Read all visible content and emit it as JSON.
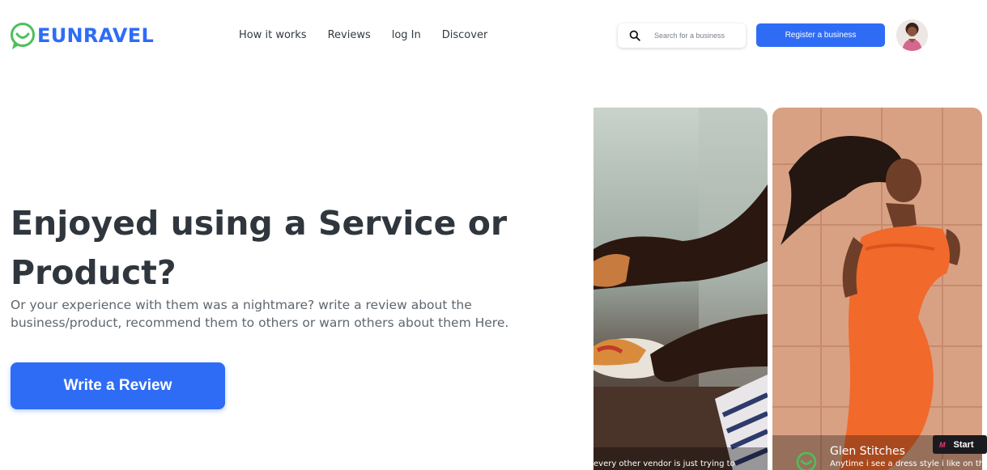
{
  "brand": {
    "name": "EUNRAVEL",
    "logo_icon": "chat-smile-icon",
    "colors": {
      "primary": "#2f6cf6",
      "logo_green": "#4cc05a"
    }
  },
  "nav": {
    "items": [
      "How it works",
      "Reviews",
      "log In",
      "Discover"
    ]
  },
  "search": {
    "placeholder": "Search for a business",
    "icon": "search-icon"
  },
  "header": {
    "register_label": "Register a business",
    "avatar": "user-avatar"
  },
  "hero": {
    "title": "Enjoyed using a Service or Product?",
    "subtitle": "Or your experience with them was a nightmare? write a review about the business/product, recommend them to others or warn others about them Here.",
    "cta_label": "Write a Review"
  },
  "cards": [
    {
      "caption": "every other vendor is just trying to"
    },
    {
      "reviewer": "Glen Stitches",
      "caption": "Anytime i see a dress style i like on th"
    }
  ],
  "widget": {
    "mark": "M",
    "label": "Start"
  }
}
